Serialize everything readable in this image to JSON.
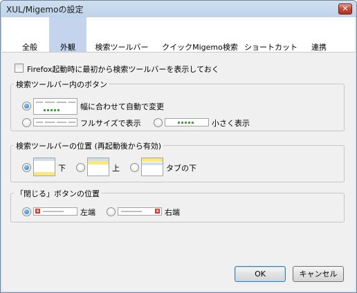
{
  "window": {
    "title": "XUL/Migemoの設定",
    "close_glyph": "✕"
  },
  "tabs": [
    {
      "label": "全般"
    },
    {
      "label": "外観",
      "selected": true
    },
    {
      "label": "検索ツールバー"
    },
    {
      "label": "クイックMigemo検索"
    },
    {
      "label": "ショートカット"
    },
    {
      "label": "連携"
    }
  ],
  "startup_checkbox": {
    "label": "Firefox起動時に最初から検索ツールバーを表示しておく",
    "checked": false
  },
  "buttons_group": {
    "title": "検索ツールバー内のボタン",
    "options": [
      {
        "label": "幅に合わせて自動で変更",
        "selected": true
      },
      {
        "label": "フルサイズで表示",
        "selected": false
      },
      {
        "label": "小さく表示",
        "selected": false
      }
    ]
  },
  "position_group": {
    "title": "検索ツールバーの位置 (再起動後から有効)",
    "options": [
      {
        "label": "下",
        "selected": true
      },
      {
        "label": "上",
        "selected": false
      },
      {
        "label": "タブの下",
        "selected": false
      }
    ]
  },
  "close_group": {
    "title": "「閉じる」ボタンの位置",
    "options": [
      {
        "label": "左端",
        "selected": true
      },
      {
        "label": "右端",
        "selected": false
      }
    ]
  },
  "footer": {
    "ok_label": "OK",
    "cancel_label": "キャンセル"
  },
  "colors": {
    "accent_tab": "#c4d4ec",
    "toolbar_yellow": "#fde77a",
    "close_red": "#d23a26"
  }
}
